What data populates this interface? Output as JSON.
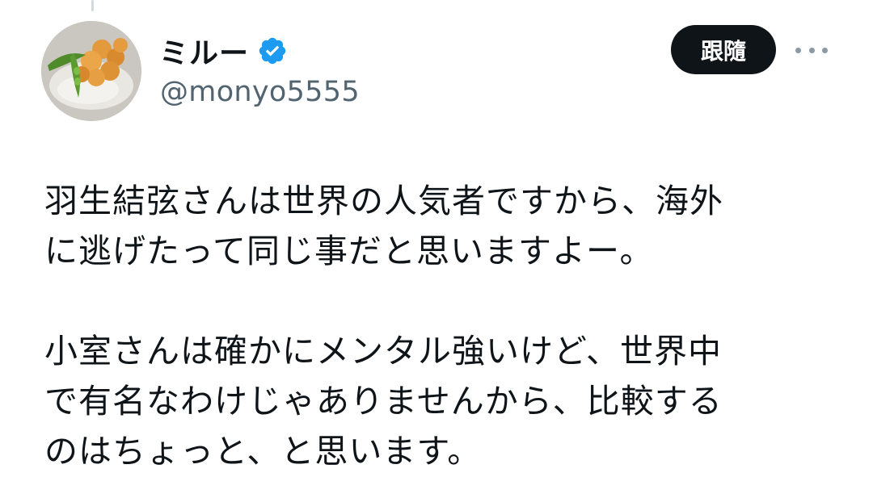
{
  "tweet": {
    "author": {
      "display_name": "ミルー",
      "handle": "@monyo5555",
      "verified": true,
      "avatar_icon": "food-photo-avatar",
      "verified_icon": "verified-badge-icon"
    },
    "follow_button_label": "跟隨",
    "more_icon": "more-options-icon",
    "paragraphs": [
      {
        "lines": [
          "羽生結弦さんは世界の人気者ですから、海外",
          "に逃げたって同じ事だと思いますよー。"
        ]
      },
      {
        "lines": [
          "小室さんは確かにメンタル強いけど、世界中",
          "で有名なわけじゃありませんから、比較する",
          "のはちょっと、と思います。"
        ]
      }
    ]
  },
  "colors": {
    "text": "#0f1419",
    "secondary_text": "#536471",
    "verified_blue": "#1d9bf0",
    "button_background": "#0f1419"
  }
}
